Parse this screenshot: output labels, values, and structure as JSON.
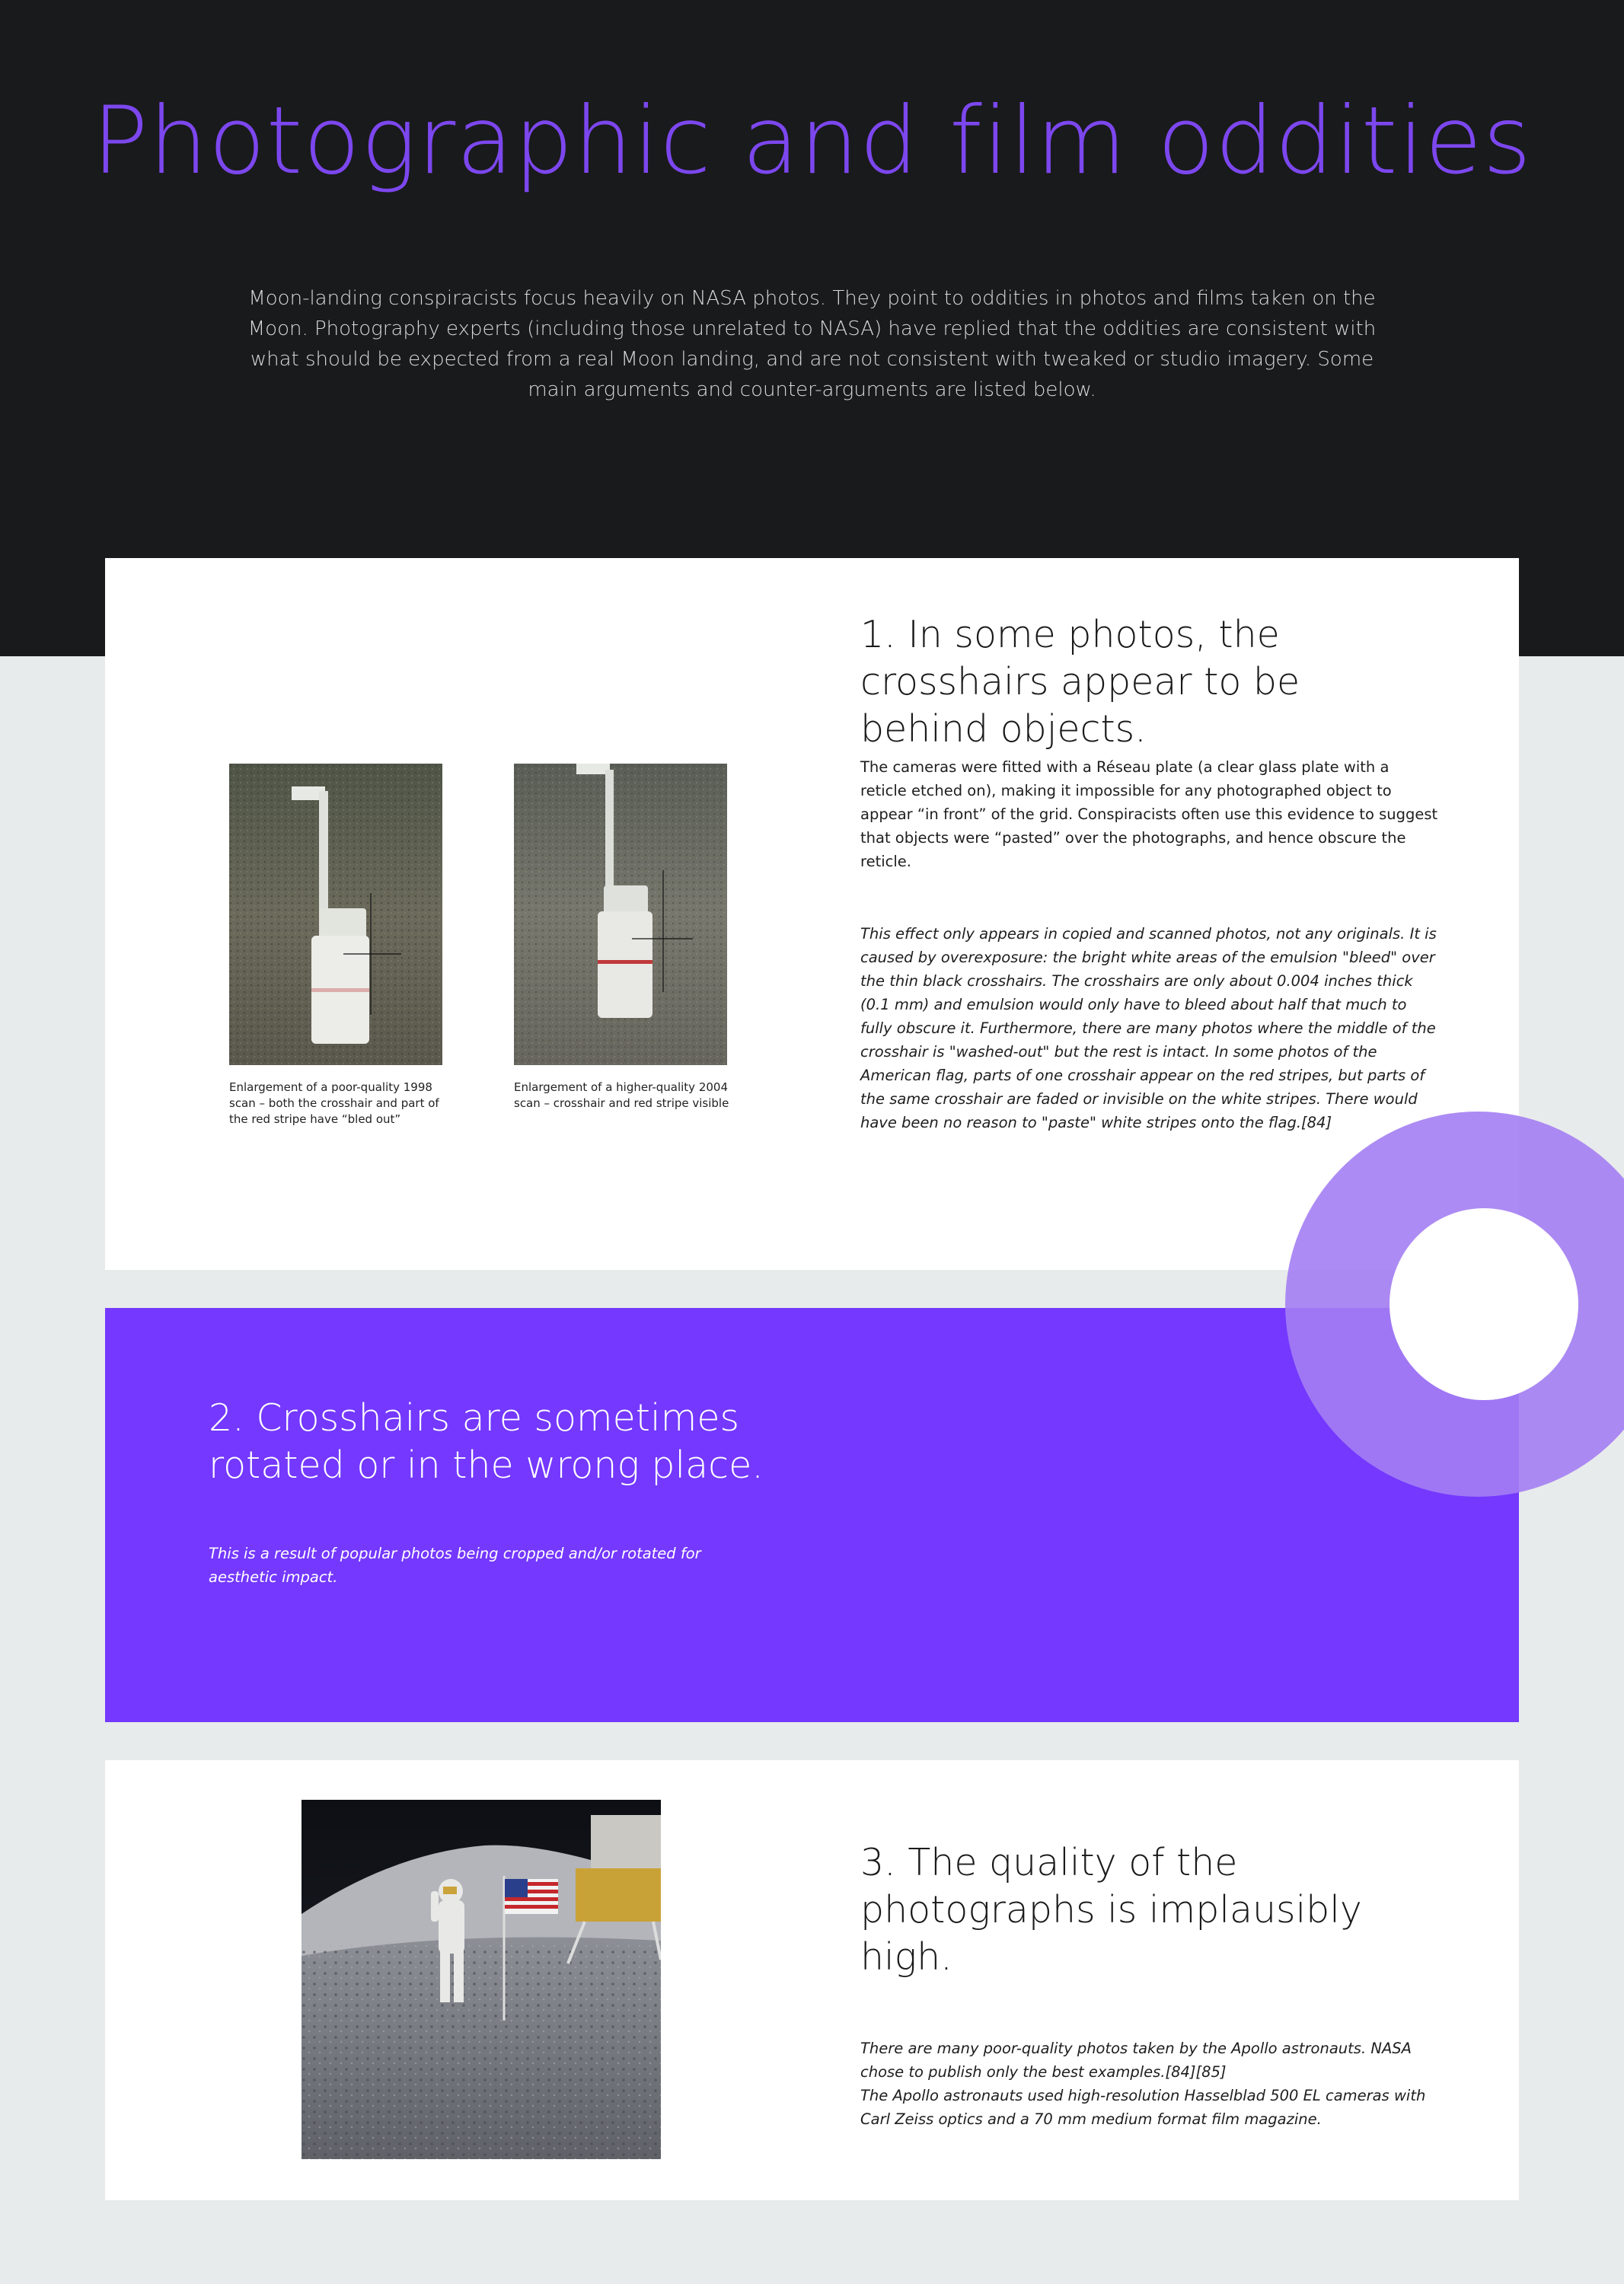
{
  "header": {
    "title": "Photographic and film oddities",
    "intro": "Moon-landing conspiracists focus heavily on NASA photos. They point to oddities in photos and films taken on the Moon. Photography experts (including those unrelated to NASA) have replied that the oddities are consistent with what should be expected from a real Moon landing, and are not consistent with tweaked or studio imagery. Some main arguments and counter-arguments are listed below."
  },
  "section1": {
    "heading": "1. In some photos, the crosshairs appear to be behind objects.",
    "claim": "The cameras were fitted with a Réseau plate (a clear glass plate with a reticle etched on), making it impossible for any photographed object to appear “in front” of the grid. Conspiracists often use this evidence to suggest that objects were “pasted” over the photographs, and hence obscure the reticle.",
    "response": "This effect only appears in copied and scanned photos, not any originals. It is caused by overexposure: the bright white areas of the emulsion \"bleed\" over the thin black crosshairs. The crosshairs are only about 0.004 inches thick (0.1 mm) and emulsion would only have to bleed about half that much to fully obscure it. Furthermore, there are many photos where the middle of the crosshair is \"washed-out\" but the rest is intact. In some photos of the American flag, parts of one crosshair appear on the red stripes, but parts of the same crosshair are faded or invisible on the white stripes. There would have been no reason to \"paste\" white stripes onto the flag.[84]",
    "caption_left": "Enlargement of a poor-quality 1998 scan – both the crosshair and part of the red stripe have “bled out”",
    "caption_right": "Enlargement of a higher-quality 2004 scan – crosshair and red stripe visible"
  },
  "section2": {
    "heading": "2. Crosshairs are sometimes rotated or in the wrong place.",
    "response": "This is a result of popular photos being cropped and/or rotated for aesthetic impact."
  },
  "section3": {
    "heading": "3. The quality of the photographs is implausibly high.",
    "response_1": "There are many poor-quality photos taken by the Apollo astronauts. NASA chose to publish only the best examples.[84][85]",
    "response_2": "The Apollo astronauts used high-resolution Hasselblad 500 EL cameras with Carl Zeiss optics and a 70 mm medium format film magazine."
  },
  "colors": {
    "accent": "#7438ff",
    "title": "#7c47ee",
    "dark": "#191a1b",
    "ring": "#a47ef3"
  }
}
